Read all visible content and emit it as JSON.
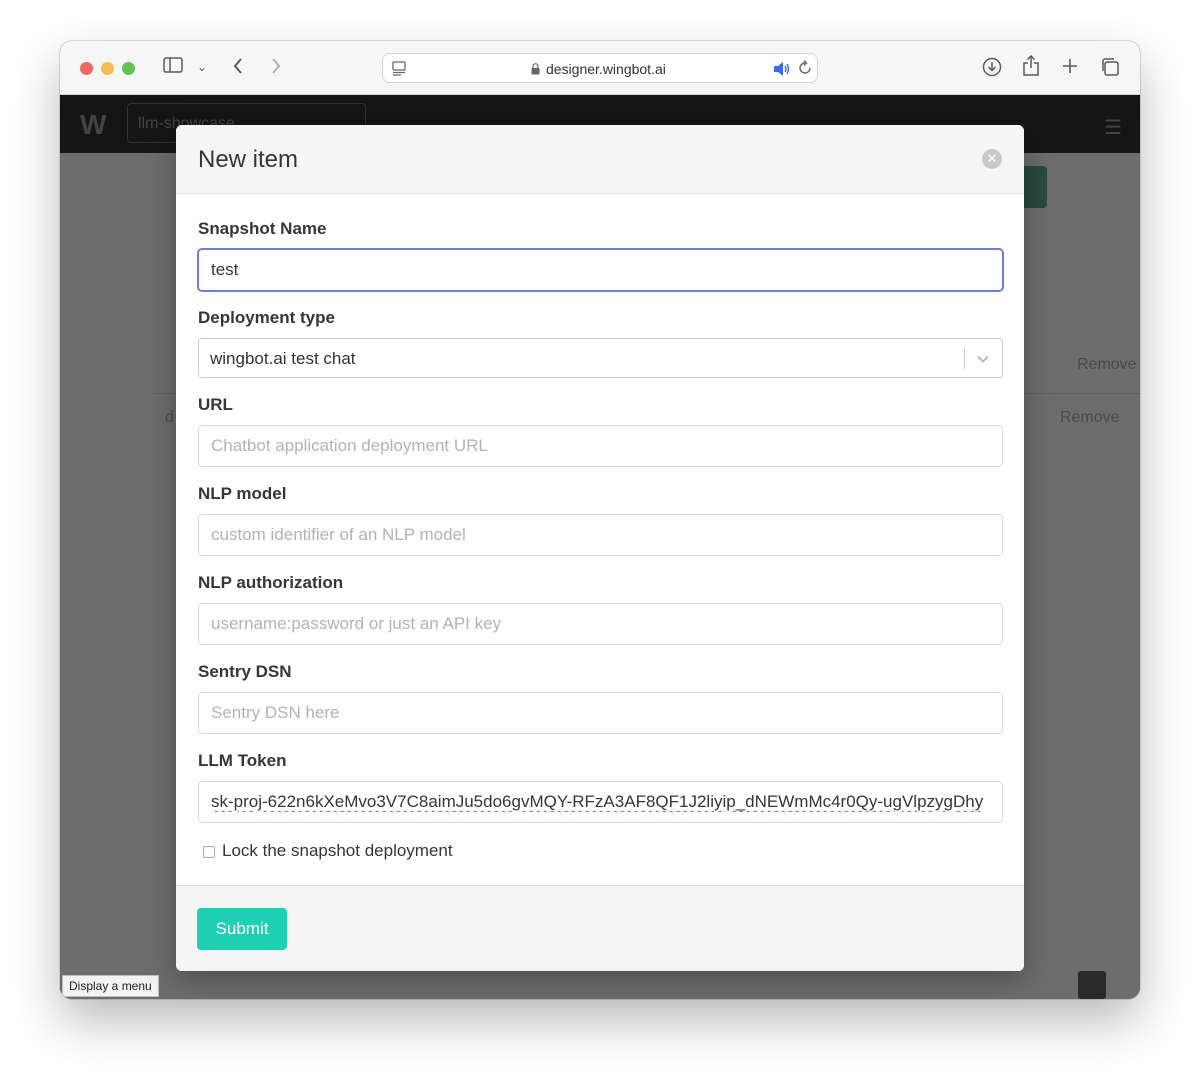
{
  "browser": {
    "url": "designer.wingbot.ai",
    "tooltip": "Display a menu"
  },
  "background": {
    "project_name": "llm-showcase",
    "remove_label_1": "Remove",
    "remove_label_2": "Remove",
    "row_initial": "d"
  },
  "modal": {
    "title": "New item",
    "fields": {
      "snapshot_name": {
        "label": "Snapshot Name",
        "value": "test"
      },
      "deployment_type": {
        "label": "Deployment type",
        "value": "wingbot.ai test chat"
      },
      "url": {
        "label": "URL",
        "value": "",
        "placeholder": "Chatbot application deployment URL"
      },
      "nlp_model": {
        "label": "NLP model",
        "value": "",
        "placeholder": "custom identifier of an NLP model"
      },
      "nlp_auth": {
        "label": "NLP authorization",
        "value": "",
        "placeholder": "username:password or just an API key"
      },
      "sentry_dsn": {
        "label": "Sentry DSN",
        "value": "",
        "placeholder": "Sentry DSN here"
      },
      "llm_token": {
        "label": "LLM Token",
        "value": "sk-proj-622n6kXeMvo3V7C8aimJu5do6gvMQY-RFzA3AF8QF1J2liyip_dNEWmMc4r0Qy-ugVlpzygDhy"
      }
    },
    "lock_label": "Lock the snapshot deployment",
    "submit_label": "Submit"
  },
  "colors": {
    "accent": "#1fd1b2",
    "focus": "#6f7ed6"
  }
}
